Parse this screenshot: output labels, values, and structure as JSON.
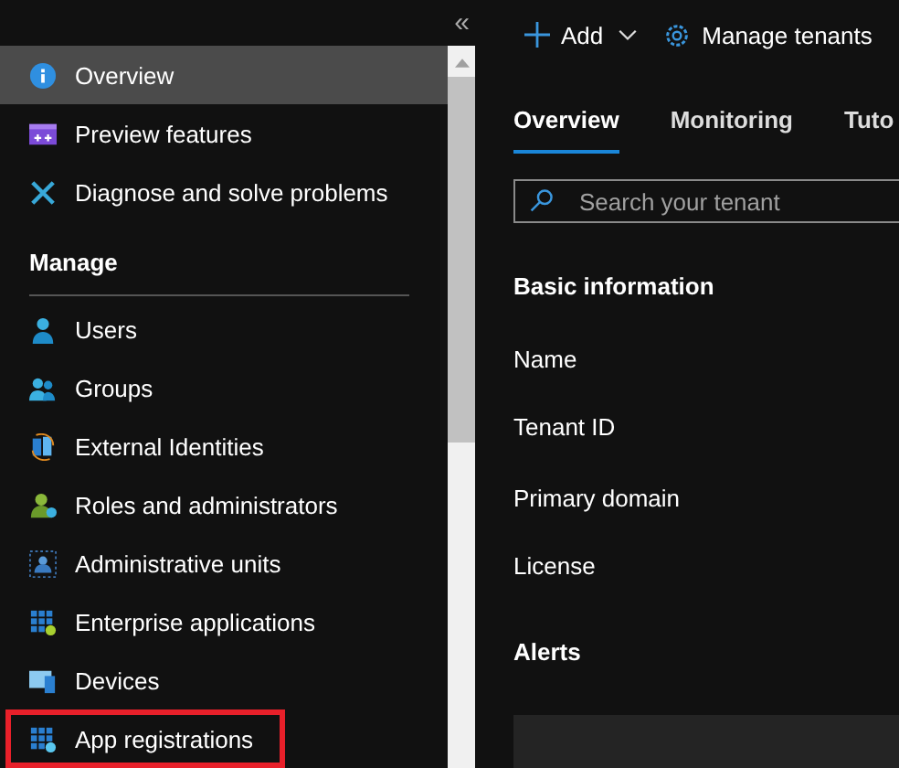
{
  "sidebar": {
    "collapse_glyph": "«",
    "items": [
      {
        "label": "Overview",
        "selected": true,
        "outlined": false
      },
      {
        "label": "Preview features",
        "selected": false,
        "outlined": false
      },
      {
        "label": "Diagnose and solve problems",
        "selected": false,
        "outlined": false
      }
    ],
    "section": {
      "heading": "Manage",
      "items": [
        {
          "label": "Users",
          "selected": false,
          "outlined": false
        },
        {
          "label": "Groups",
          "selected": false,
          "outlined": false
        },
        {
          "label": "External Identities",
          "selected": false,
          "outlined": false
        },
        {
          "label": "Roles and administrators",
          "selected": false,
          "outlined": false
        },
        {
          "label": "Administrative units",
          "selected": false,
          "outlined": false
        },
        {
          "label": "Enterprise applications",
          "selected": false,
          "outlined": false
        },
        {
          "label": "Devices",
          "selected": false,
          "outlined": false
        },
        {
          "label": "App registrations",
          "selected": false,
          "outlined": true
        }
      ]
    }
  },
  "toolbar": {
    "add": "Add",
    "manage": "Manage tenants"
  },
  "tabs": [
    {
      "label": "Overview",
      "selected": true
    },
    {
      "label": "Monitoring",
      "selected": false
    },
    {
      "label": "Tuto",
      "selected": false
    }
  ],
  "search": {
    "placeholder": "Search your tenant"
  },
  "basic": {
    "heading": "Basic information",
    "labels": [
      "Name",
      "Tenant ID",
      "Primary domain",
      "License"
    ]
  },
  "alerts": {
    "heading": "Alerts"
  }
}
